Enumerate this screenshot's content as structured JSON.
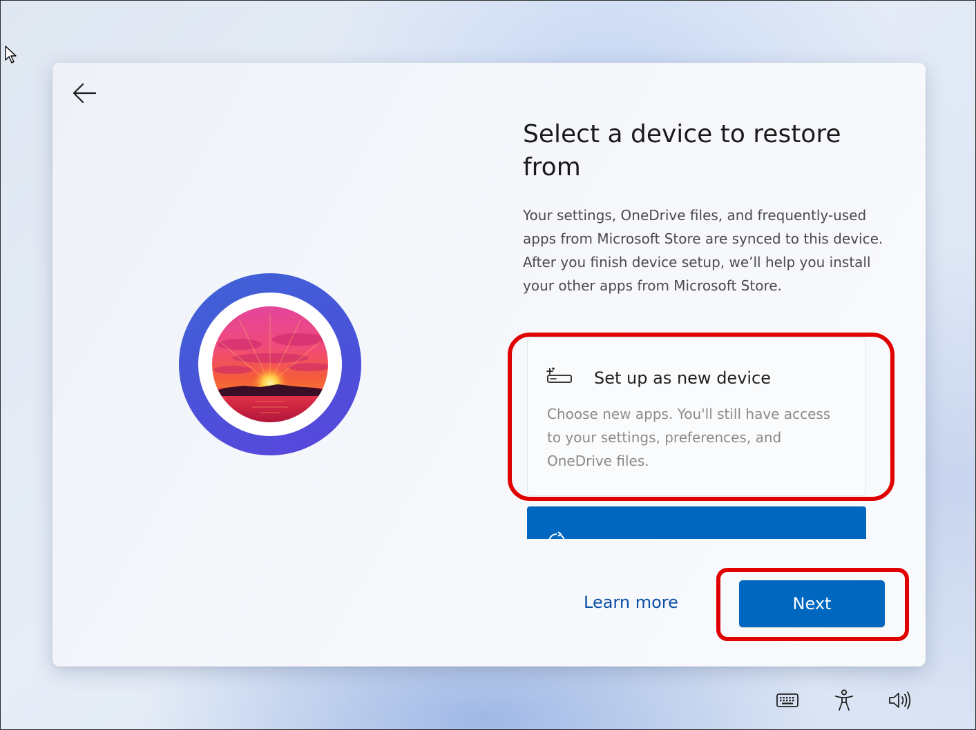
{
  "navigation": {
    "back_icon": "arrow-left-icon"
  },
  "page": {
    "title": "Select a device to restore from",
    "description": "Your settings, OneDrive files, and frequently-used apps from Microsoft Store are synced to this device. After you finish device setup, we’ll help you install your other apps from Microsoft Store."
  },
  "hero": {
    "ring_color": "#4a52d9"
  },
  "options": [
    {
      "icon": "new-device-icon",
      "title": "Set up as new device",
      "description": "Choose new apps. You'll still have access to your settings, preferences, and OneDrive files."
    },
    {
      "icon": "restore-device-icon",
      "selected": true
    }
  ],
  "footer": {
    "learn_more_label": "Learn more",
    "next_label": "Next"
  },
  "system_tray": [
    {
      "icon": "keyboard-icon"
    },
    {
      "icon": "accessibility-icon"
    },
    {
      "icon": "volume-icon"
    }
  ],
  "colors": {
    "accent": "#0067c0",
    "highlight_annotation": "#e00000",
    "link": "#0a4fa6"
  }
}
